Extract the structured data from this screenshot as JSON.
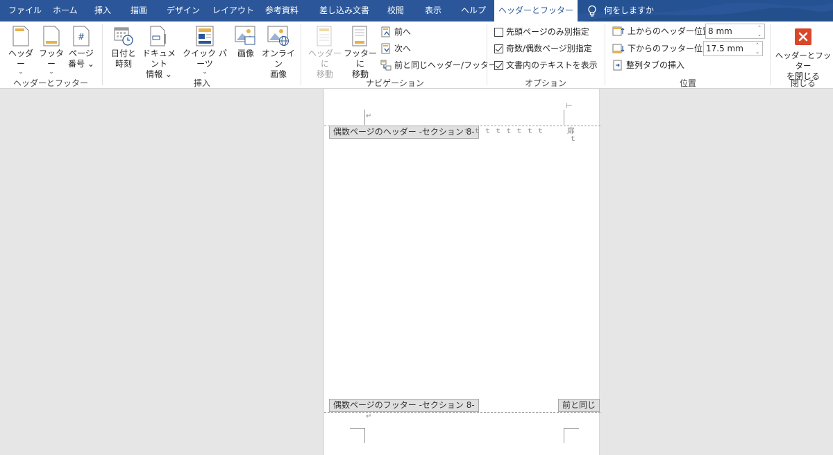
{
  "tabs": [
    {
      "id": "file",
      "label": "ファイル"
    },
    {
      "id": "home",
      "label": "ホーム"
    },
    {
      "id": "insert",
      "label": "挿入"
    },
    {
      "id": "draw",
      "label": "描画"
    },
    {
      "id": "design",
      "label": "デザイン"
    },
    {
      "id": "layout",
      "label": "レイアウト"
    },
    {
      "id": "references",
      "label": "参考資料"
    },
    {
      "id": "mailings",
      "label": "差し込み文書"
    },
    {
      "id": "review",
      "label": "校閲"
    },
    {
      "id": "view",
      "label": "表示"
    },
    {
      "id": "help",
      "label": "ヘルプ"
    },
    {
      "id": "header-footer",
      "label": "ヘッダーとフッター",
      "active": true
    }
  ],
  "tell_me": {
    "label": "何をしますか",
    "icon": "lightbulb-icon"
  },
  "ribbon": {
    "header_footer_group": {
      "label": "ヘッダーとフッター",
      "header": {
        "line1": "ヘッダー",
        "chev": "⌄"
      },
      "footer": {
        "line1": "フッター",
        "chev": "⌄"
      },
      "page_number": {
        "line1": "ページ",
        "line2": "番号 ⌄"
      }
    },
    "insert_group": {
      "label": "挿入",
      "date_time": {
        "line1": "日付と",
        "line2": "時刻"
      },
      "doc_info": {
        "line1": "ドキュメント",
        "line2": "情報 ⌄"
      },
      "quick_parts": {
        "line1": "クイック パーツ",
        "chev": "⌄"
      },
      "picture": {
        "line1": "画像"
      },
      "online_picture": {
        "line1": "オンライン",
        "line2": "画像"
      }
    },
    "navigation_group": {
      "label": "ナビゲーション",
      "goto_header": {
        "line1": "ヘッダーに",
        "line2": "移動"
      },
      "goto_footer": {
        "line1": "フッターに",
        "line2": "移動"
      },
      "previous": "前へ",
      "next": "次へ",
      "link_previous": "前と同じヘッダー/フッター"
    },
    "options_group": {
      "label": "オプション",
      "different_first": {
        "label": "先頭ページのみ別指定",
        "checked": false
      },
      "different_odd_even": {
        "label": "奇数/偶数ページ別指定",
        "checked": true
      },
      "show_text": {
        "label": "文書内のテキストを表示",
        "checked": true
      }
    },
    "position_group": {
      "label": "位置",
      "header_from_top": {
        "label": "上からのヘッダー位置:",
        "value": "8 mm"
      },
      "footer_from_bottom": {
        "label": "下からのフッター位置:",
        "value": "17.5 mm"
      },
      "insert_align_tab": "整列タブの挿入"
    },
    "close_group": {
      "label": "閉じる",
      "close": {
        "line1": "ヘッダーとフッター",
        "line2": "を閉じる"
      }
    }
  },
  "document": {
    "header_tag": "偶数ページのヘッダー -セクション 8-",
    "footer_tag": "偶数ページのフッター -セクション 8-",
    "same_as_previous": "前と同じ",
    "para_mark": "↵",
    "tab_marks": "ｔ ｔ ｔ ｔ ｔ ｔ ｔ ｔ",
    "header_char": "扉",
    "header_tab_end": "ｔ",
    "cursor_mark": "⊢"
  },
  "colors": {
    "accent": "#2b579a",
    "close_red": "#d9472b"
  }
}
